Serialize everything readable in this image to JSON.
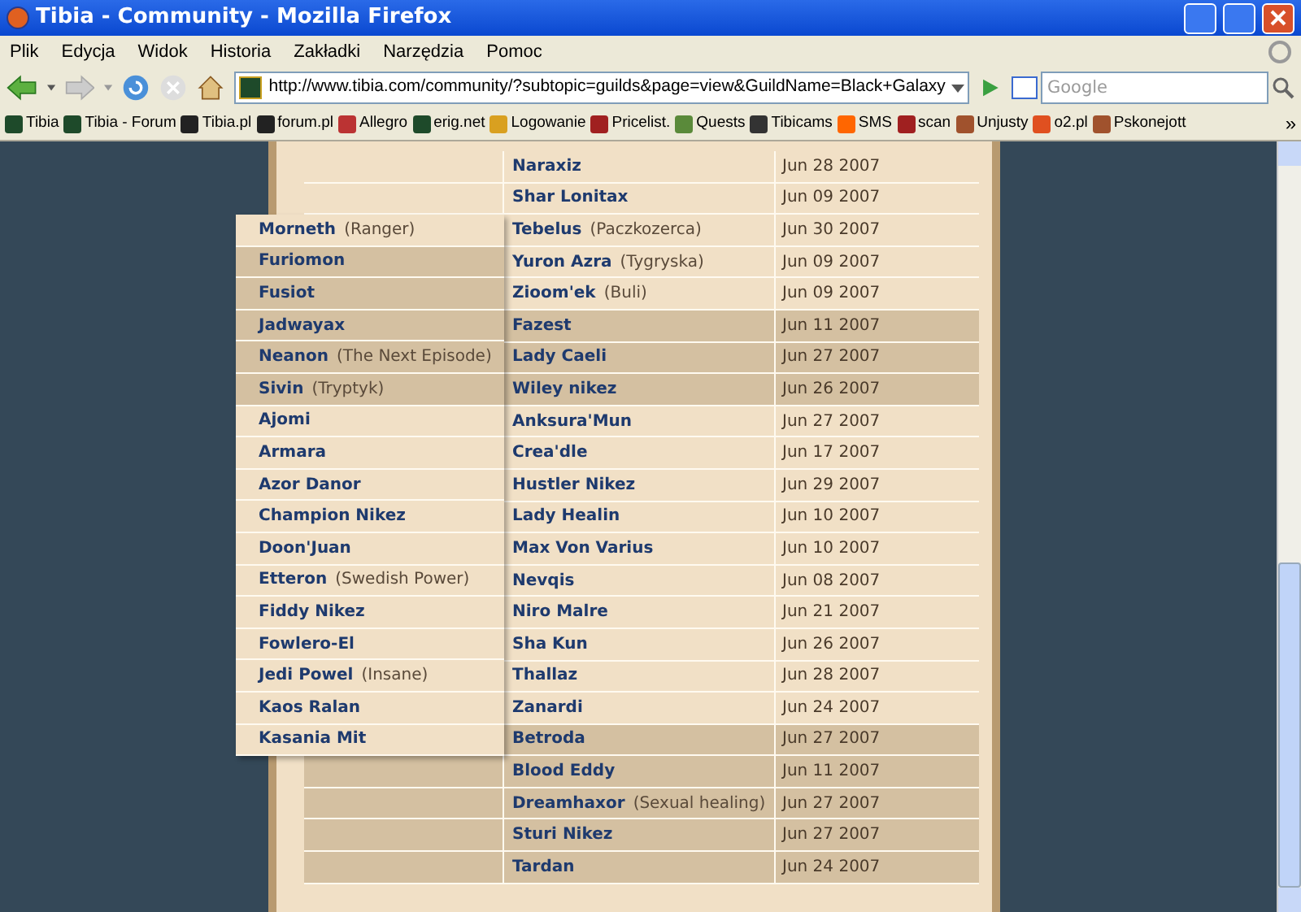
{
  "window": {
    "title": "Tibia - Community - Mozilla Firefox"
  },
  "menu": [
    "Plik",
    "Edycja",
    "Widok",
    "Historia",
    "Zakładki",
    "Narzędzia",
    "Pomoc"
  ],
  "address": {
    "value": "http://www.tibia.com/community/?subtopic=guilds&page=view&GuildName=Black+Galaxy"
  },
  "search": {
    "placeholder": "Google"
  },
  "bookmarks": [
    "Tibia",
    "Tibia - Forum",
    "Tibia.pl",
    "forum.pl",
    "Allegro",
    "erig.net",
    "Logowanie",
    "Pricelist.",
    "Quests",
    "Tibicams",
    "SMS",
    "scan",
    "Unjusty",
    "o2.pl",
    "Pskonejott"
  ],
  "bookmarks_more": "»",
  "table": {
    "rows": [
      {
        "name": "Naraxiz",
        "date": "Jun 28 2007",
        "shaded": false
      },
      {
        "name": "Shar Lonitax",
        "date": "Jun 09 2007",
        "shaded": false
      },
      {
        "name": "Tebelus",
        "title": "(Paczkozerca)",
        "date": "Jun 30 2007",
        "shaded": false
      },
      {
        "name": "Yuron Azra",
        "title": "(Tygryska)",
        "date": "Jun 09 2007",
        "shaded": false
      },
      {
        "name": "Zioom'ek",
        "title": "(Buli)",
        "date": "Jun 09 2007",
        "shaded": false
      },
      {
        "name": "Fazest",
        "date": "Jun 11 2007",
        "shaded": true
      },
      {
        "name": "Lady Caeli",
        "date": "Jun 27 2007",
        "shaded": true
      },
      {
        "name": "Wiley nikez",
        "date": "Jun 26 2007",
        "shaded": true
      },
      {
        "name": "Anksura'Mun",
        "date": "Jun 27 2007",
        "shaded": false
      },
      {
        "name": "Crea'dle",
        "date": "Jun 17 2007",
        "shaded": false
      },
      {
        "name": "Hustler Nikez",
        "date": "Jun 29 2007",
        "shaded": false
      },
      {
        "name": "Lady Healin",
        "date": "Jun 10 2007",
        "shaded": false
      },
      {
        "name": "Max Von Varius",
        "date": "Jun 10 2007",
        "shaded": false
      },
      {
        "name": "Nevqis",
        "date": "Jun 08 2007",
        "shaded": false
      },
      {
        "name": "Niro Malre",
        "date": "Jun 21 2007",
        "shaded": false
      },
      {
        "name": "Sha Kun",
        "date": "Jun 26 2007",
        "shaded": false
      },
      {
        "name": "Thallaz",
        "date": "Jun 28 2007",
        "shaded": false
      },
      {
        "name": "Zanardi",
        "date": "Jun 24 2007",
        "shaded": false
      },
      {
        "name": "Betroda",
        "date": "Jun 27 2007",
        "shaded": true
      },
      {
        "name": "Blood Eddy",
        "date": "Jun 11 2007",
        "shaded": true
      },
      {
        "name": "Dreamhaxor",
        "title": "(Sexual healing)",
        "date": "Jun 27 2007",
        "shaded": true
      },
      {
        "name": "Sturi Nikez",
        "date": "Jun 27 2007",
        "shaded": true
      },
      {
        "name": "Tardan",
        "date": "Jun 24 2007",
        "shaded": true
      }
    ]
  },
  "overlay_list": {
    "items": [
      {
        "name": "Morneth",
        "title": "(Ranger)",
        "shaded": false
      },
      {
        "name": "Furiomon",
        "shaded": true
      },
      {
        "name": "Fusiot",
        "shaded": true
      },
      {
        "name": "Jadwayax",
        "shaded": true
      },
      {
        "name": "Neanon",
        "title": "(The Next Episode)",
        "shaded": true
      },
      {
        "name": "Sivin",
        "title": "(Tryptyk)",
        "shaded": true
      },
      {
        "name": "Ajomi",
        "shaded": false
      },
      {
        "name": "Armara",
        "shaded": false
      },
      {
        "name": "Azor Danor",
        "shaded": false
      },
      {
        "name": "Champion Nikez",
        "shaded": false
      },
      {
        "name": "Doon'Juan",
        "shaded": false
      },
      {
        "name": "Etteron",
        "title": "(Swedish Power)",
        "shaded": false
      },
      {
        "name": "Fiddy Nikez",
        "shaded": false
      },
      {
        "name": "Fowlero-El",
        "shaded": false
      },
      {
        "name": "Jedi Powel",
        "title": "(Insane)",
        "shaded": false
      },
      {
        "name": "Kaos Ralan",
        "shaded": false
      },
      {
        "name": "Kasania Mit",
        "shaded": false
      }
    ]
  }
}
